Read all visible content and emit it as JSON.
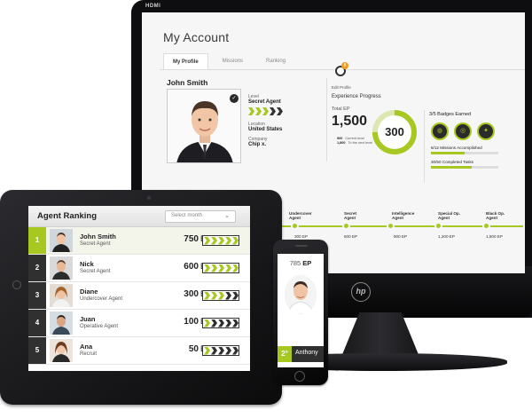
{
  "monitor": {
    "port_label": "HDMI",
    "brand": "hp",
    "page_title": "My Account",
    "tabs": [
      {
        "label": "My Profile",
        "active": true
      },
      {
        "label": "Missions",
        "active": false
      },
      {
        "label": "Ranking",
        "active": false
      }
    ],
    "notification_count": "8",
    "settings_link": "Edit Profile",
    "profile": {
      "name": "John Smith",
      "level_label": "Level",
      "level_value": "Secret Agent",
      "location_label": "Location",
      "location_value": "United States",
      "company_label": "Company",
      "company_value": "Chip x."
    },
    "experience": {
      "title": "Experience Progress",
      "total_label": "Total EP",
      "total_value": "1,500",
      "gauge_value": "300",
      "gauge_fraction": 0.75,
      "stats": [
        {
          "num": "900",
          "text": "Current level"
        },
        {
          "num": "1,800",
          "text": "To the next level"
        }
      ]
    },
    "badges": {
      "title": "3/5 Badges Earned",
      "icons": [
        "globe-badge-icon",
        "target-badge-icon",
        "spy-badge-icon"
      ],
      "progress": [
        {
          "label": "6/12 Missions Accomplished",
          "fraction": 0.5
        },
        {
          "label": "30/50 Completed Tasks",
          "fraction": 0.6
        }
      ]
    },
    "timeline": [
      {
        "label_line1": "Undercover",
        "label_line2": "Agent",
        "ep": "300 EP"
      },
      {
        "label_line1": "Secret",
        "label_line2": "Agent",
        "ep": "600 EP"
      },
      {
        "label_line1": "Intelligence",
        "label_line2": "Agent",
        "ep": "900 EP"
      },
      {
        "label_line1": "Special Op.",
        "label_line2": "Agent",
        "ep": "1,200 EP"
      },
      {
        "label_line1": "Black Op.",
        "label_line2": "Agent",
        "ep": "1,500 EP"
      }
    ]
  },
  "tablet": {
    "title": "Agent Ranking",
    "select_placeholder": "Select month",
    "rows": [
      {
        "rank": "1",
        "name": "John Smith",
        "role": "Secret Agent",
        "ep": "750",
        "unit": "EP",
        "level": 3
      },
      {
        "rank": "2",
        "name": "Nick",
        "role": "Secret Agent",
        "ep": "600",
        "unit": "EP",
        "level": 3
      },
      {
        "rank": "3",
        "name": "Diane",
        "role": "Undercover Agent",
        "ep": "300",
        "unit": "EP",
        "level": 2
      },
      {
        "rank": "4",
        "name": "Juan",
        "role": "Operative Agent",
        "ep": "100",
        "unit": "EP",
        "level": 1
      },
      {
        "rank": "5",
        "name": "Ana",
        "role": "Recruit",
        "ep": "50",
        "unit": "EP",
        "level": 1
      }
    ]
  },
  "phone": {
    "ep_value": "785",
    "ep_unit": "EP",
    "rank": "2°",
    "name": "Anthony"
  },
  "colors": {
    "accent": "#a7c721",
    "dark": "#303030",
    "muted": "#cfcfcf"
  }
}
